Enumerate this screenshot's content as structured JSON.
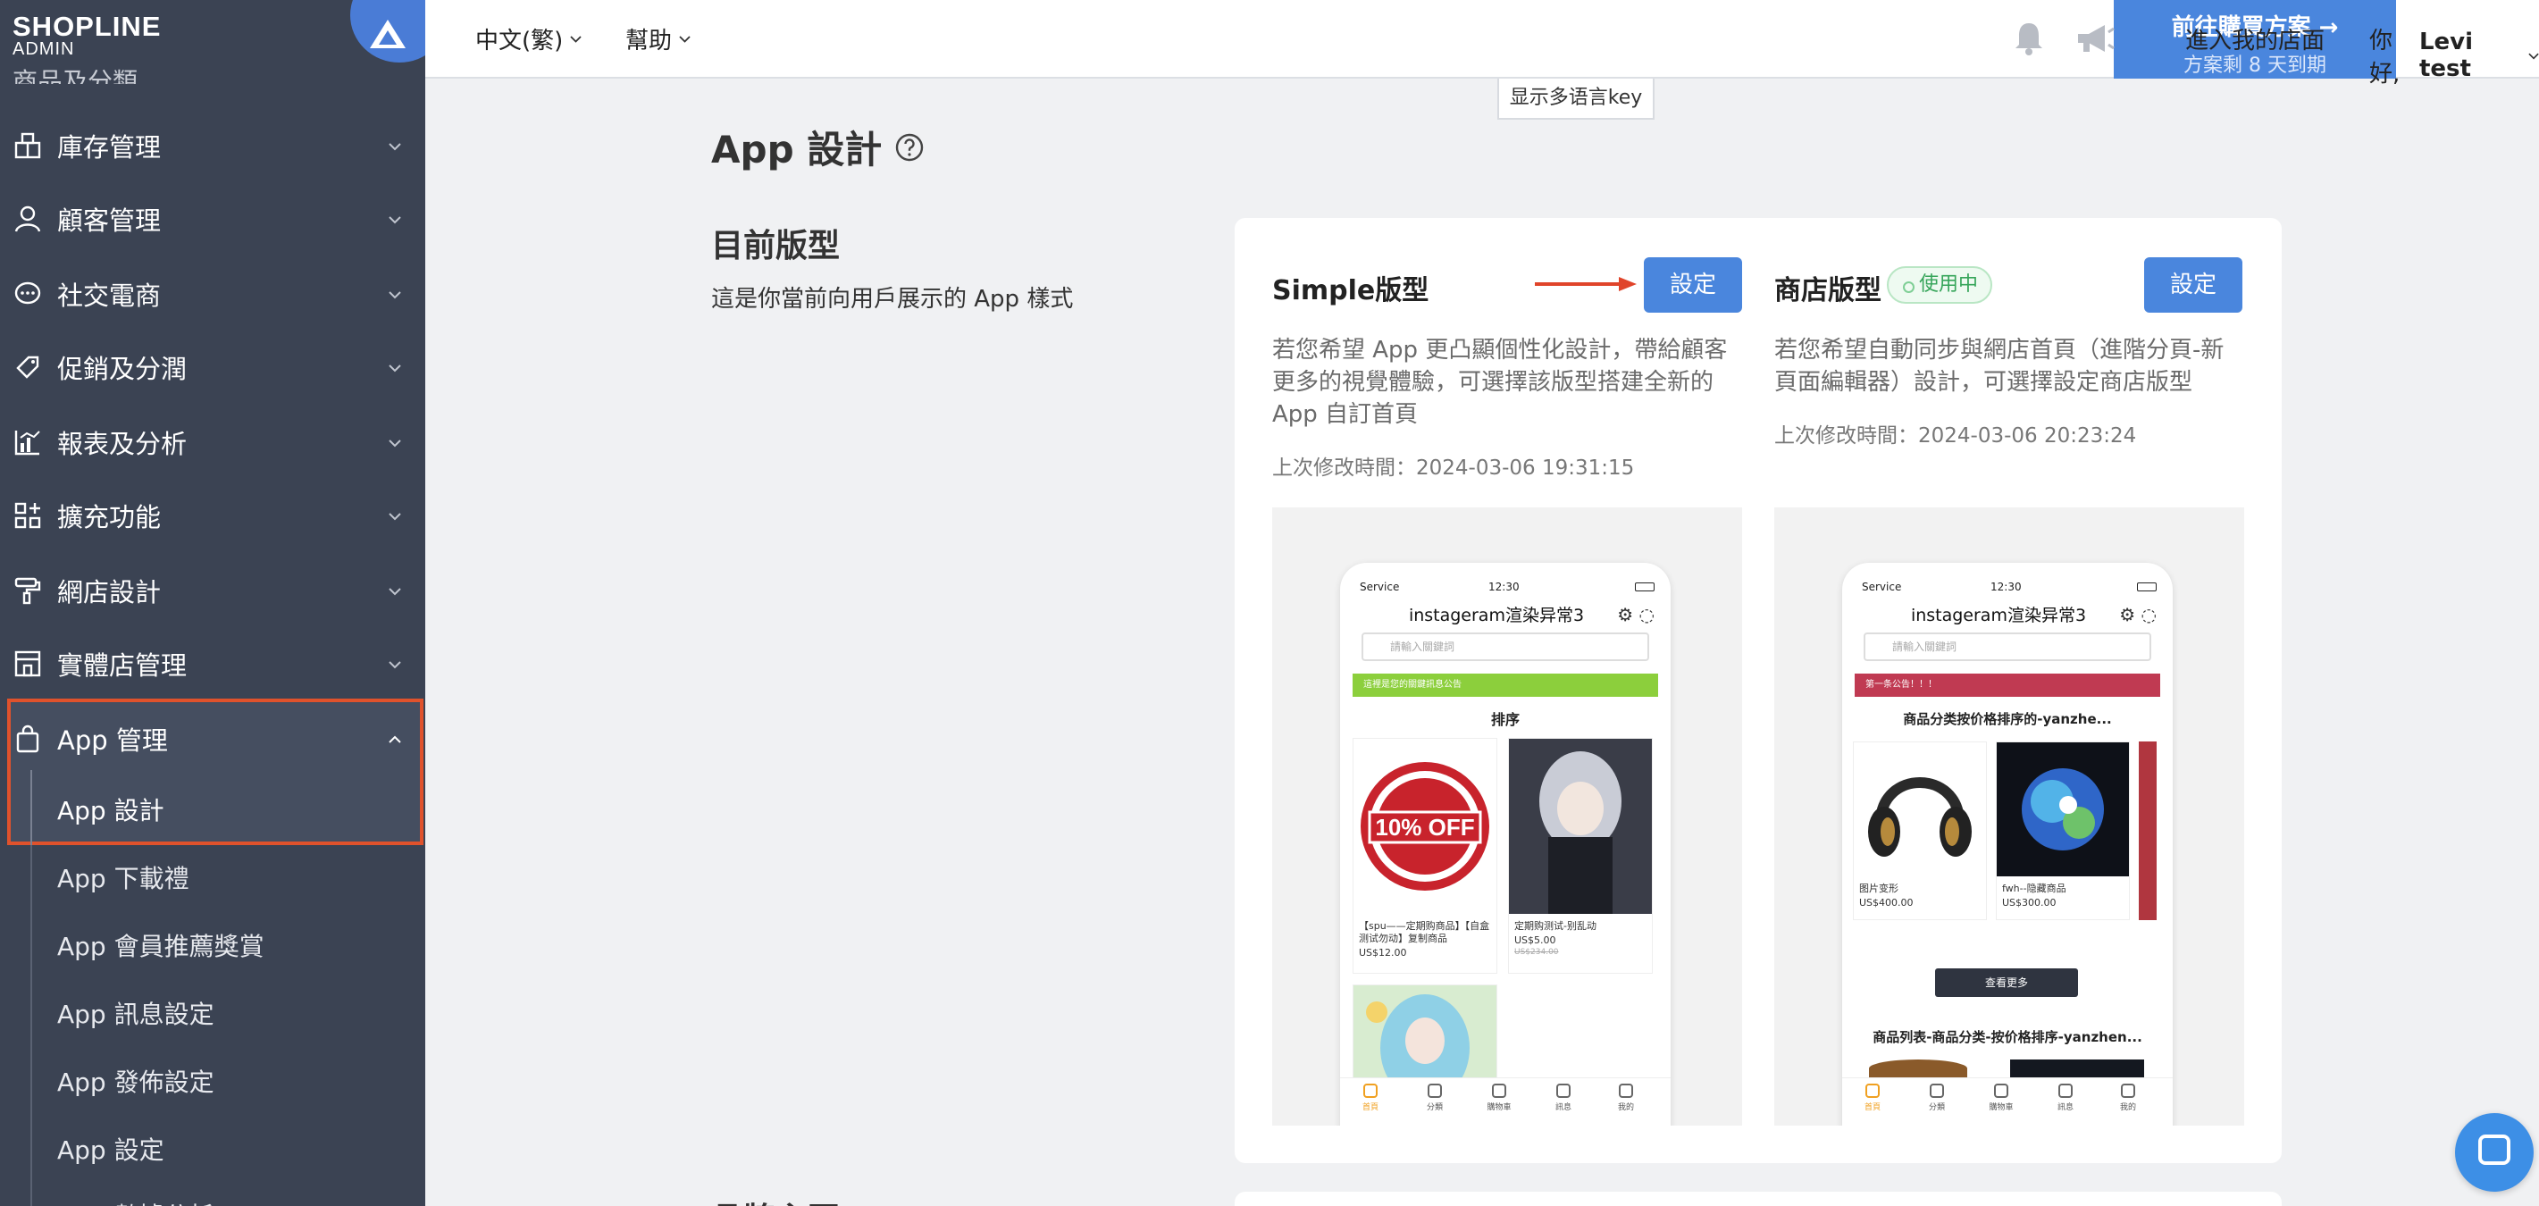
{
  "brand": {
    "logo": "SHOPLINE",
    "sub": "ADMIN"
  },
  "sidebar": {
    "partial_item": "商品及分類",
    "items": [
      {
        "label": "庫存管理",
        "icon": "inventory-icon"
      },
      {
        "label": "顧客管理",
        "icon": "customer-icon"
      },
      {
        "label": "社交電商",
        "icon": "chat-bubble-icon"
      },
      {
        "label": "促銷及分潤",
        "icon": "tag-icon"
      },
      {
        "label": "報表及分析",
        "icon": "chart-icon"
      },
      {
        "label": "擴充功能",
        "icon": "apps-grid-icon"
      },
      {
        "label": "網店設計",
        "icon": "paint-roller-icon"
      },
      {
        "label": "實體店管理",
        "icon": "store-icon"
      },
      {
        "label": "App 管理",
        "icon": "shopping-bag-icon",
        "expanded": true
      }
    ],
    "sub_items": [
      {
        "label": "App 設計",
        "active": true
      },
      {
        "label": "App 下載禮"
      },
      {
        "label": "App 會員推薦獎賞"
      },
      {
        "label": "App 訊息設定"
      },
      {
        "label": "App 發佈設定"
      },
      {
        "label": "App 設定"
      },
      {
        "label": "App 數據分析"
      }
    ]
  },
  "topbar": {
    "language": "中文(繁)",
    "help": "幫助",
    "plan_button": "前往購買方案 →",
    "plan_remaining": "方案剩 8 天到期",
    "enter_store": "進入我的店面",
    "greeting": "你好, ",
    "user_name": "Levi test"
  },
  "lang_key_button": "显示多语言key",
  "main": {
    "page_title": "App 設計",
    "section_title": "目前版型",
    "section_desc": "這是你當前向用戶展示的 App 樣式",
    "next_section_title": "品牌主頁"
  },
  "templates": [
    {
      "name": "Simple版型",
      "set_label": "設定",
      "desc": "若您希望 App 更凸顯個性化設計，帶給顧客更多的視覺體驗，可選擇該版型搭建全新的 App 自訂首頁",
      "modified": "上次修改時間：2024-03-06 19:31:15",
      "preview": {
        "status_left": "Service",
        "status_time": "12:30",
        "store_title": "instageram渲染异常3",
        "search_placeholder": "請輸入關鍵詞",
        "banner_text": "這裡是您的關鍵訊息公告",
        "banner_color": "#8ccf3c",
        "heading": "排序",
        "products": [
          {
            "name": "【spu——定期购商品】【自盒测试勿动】复制商品",
            "price": "US$12.00"
          },
          {
            "name": "定期购测试-别乱动",
            "price": "US$5.00",
            "old_price": "US$234.00"
          }
        ],
        "tabs": [
          "首頁",
          "分類",
          "購物車",
          "訊息",
          "我的"
        ]
      }
    },
    {
      "name": "商店版型",
      "in_use_label": "使用中",
      "set_label": "設定",
      "desc": "若您希望自動同步與網店首頁（進階分頁-新頁面編輯器）設計，可選擇設定商店版型",
      "modified": "上次修改時間：2024-03-06 20:23:24",
      "preview": {
        "status_left": "Service",
        "status_time": "12:30",
        "store_title": "instageram渲染异常3",
        "search_placeholder": "請輸入關鍵詞",
        "banner_text": "第一条公告！！！",
        "banner_color": "#c03a52",
        "heading": "商品分类按价格排序的-yanzhe...",
        "products": [
          {
            "name": "图片变形",
            "price": "US$400.00"
          },
          {
            "name": "fwh--隐藏商品",
            "price": "US$300.00"
          }
        ],
        "more_button": "查看更多",
        "heading2": "商品列表-商品分类-按价格排序-yanzhen...",
        "tabs": [
          "首頁",
          "分類",
          "購物車",
          "訊息",
          "我的"
        ]
      }
    }
  ],
  "colors": {
    "sidebar_bg": "#3b4353",
    "primary": "#4a86dd",
    "highlight_border": "#e0522c",
    "in_use_green": "#36a55a"
  }
}
